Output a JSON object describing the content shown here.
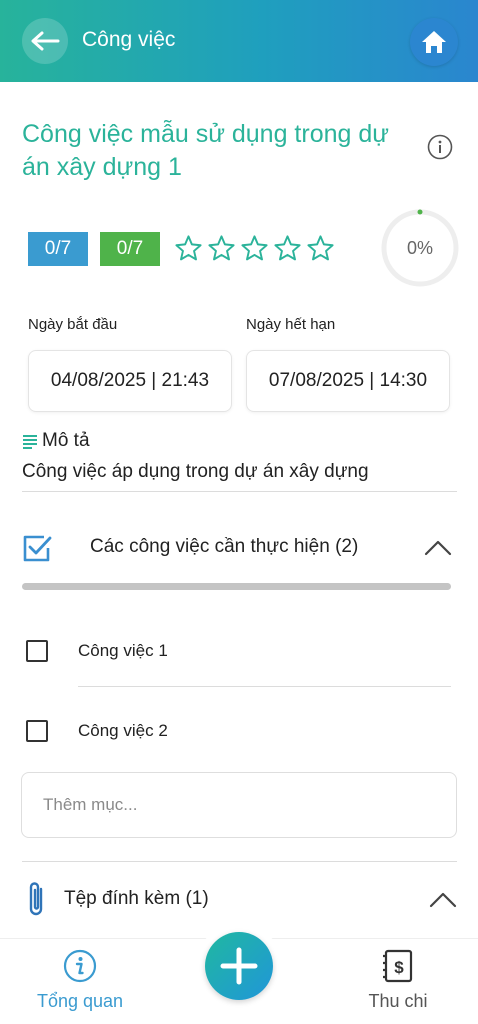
{
  "header": {
    "title": "Công việc",
    "accent_color": "#27b39b",
    "back_icon": "arrow-left-icon",
    "home_icon": "home-icon"
  },
  "task": {
    "title": "Công việc mẫu sử dụng trong dự án xây dựng 1",
    "title_color": "#2bb39a",
    "badge_blue": "0/7",
    "badge_blue_color": "#3a9bd0",
    "badge_green": "0/7",
    "badge_green_color": "#4fb34a",
    "rating": 0,
    "rating_max": 5,
    "progress_percent": 0,
    "progress_text": "0%"
  },
  "dates": {
    "start_label": "Ngày bắt đầu",
    "start_value": "04/08/2025 | 21:43",
    "end_label": "Ngày hết hạn",
    "end_value": "07/08/2025 | 14:30"
  },
  "description": {
    "label": "Mô tả",
    "text": "Công việc áp dụng trong dự án xây dựng"
  },
  "checklist": {
    "title": "Các công việc cần thực hiện (2)",
    "completed_fraction": 0,
    "items": [
      {
        "label": "Công việc 1",
        "checked": false
      },
      {
        "label": "Công việc 2",
        "checked": false
      }
    ],
    "add_placeholder": "Thêm mục..."
  },
  "attachments": {
    "title": "Tệp đính kèm (1)"
  },
  "bottom_nav": {
    "overview_label": "Tổng quan",
    "overview_color": "#3a9bd0",
    "finance_label": "Thu chi",
    "finance_color": "#555555",
    "fab_icon": "plus-icon"
  }
}
